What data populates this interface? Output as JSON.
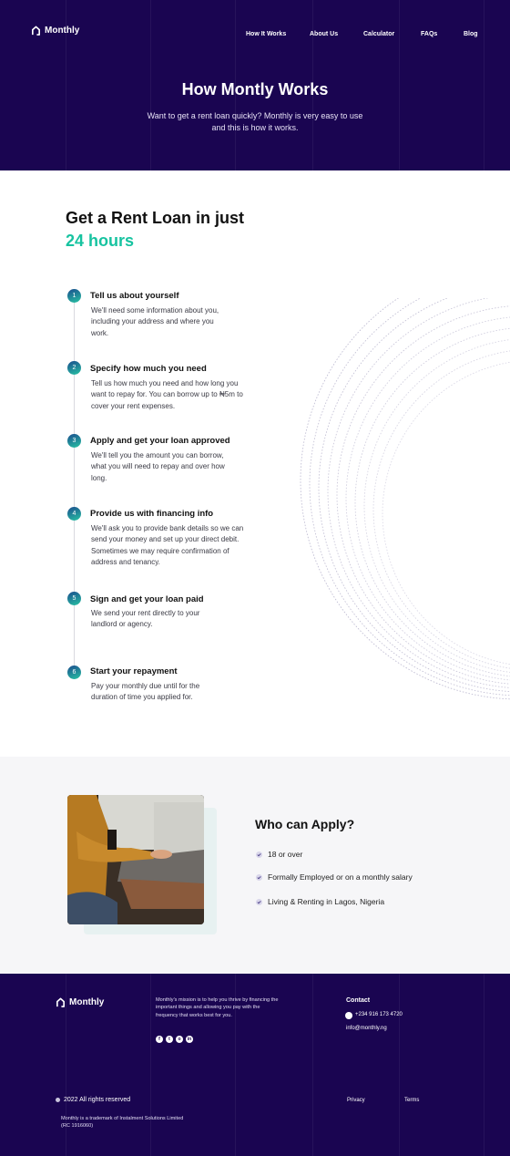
{
  "header": {
    "logo_text": "Monthly",
    "nav": [
      "How It Works",
      "About Us",
      "Calculator",
      "FAQs",
      "Blog"
    ],
    "title": "How Montly Works",
    "subtitle": "Want to get a rent loan quickly? Monthly is very easy to use and this is how it works."
  },
  "steps_section": {
    "heading": "Get a Rent Loan in just",
    "heading_accent": "24 hours",
    "steps": [
      {
        "num": "1",
        "title": "Tell us about yourself",
        "text": "We'll need some information about you, including your address and where you work."
      },
      {
        "num": "2",
        "title": "Specify how much you need",
        "text": "Tell us how much you need and how long you want to repay for. You can borrow up to ₦5m to cover your rent expenses."
      },
      {
        "num": "3",
        "title": "Apply and get your loan approved",
        "text": "We'll tell you the amount you can borrow, what you will need to repay and over how long."
      },
      {
        "num": "4",
        "title": "Provide us with financing info",
        "text": "We'll ask you to provide bank details so we can send your money and set up your direct debit. Sometimes we may require confirmation of address and tenancy."
      },
      {
        "num": "5",
        "title": "Sign and get your loan paid",
        "text": "We send your rent directly to your landlord or agency."
      },
      {
        "num": "6",
        "title": "Start your repayment",
        "text": "Pay your monthly due until for the duration of time you applied for."
      }
    ]
  },
  "apply_section": {
    "title": "Who can Apply?",
    "items": [
      "18 or over",
      "Formally Employed or on a monthly salary",
      "Living & Renting in Lagos, Nigeria"
    ]
  },
  "footer": {
    "logo_text": "Monthly",
    "mission": "Monthly's mission is to help you thrive by financing the important things and allowing you pay with the frequency that works best for you.",
    "social": [
      "facebook-icon",
      "twitter-icon",
      "instagram-icon",
      "linkedin-icon"
    ],
    "contact_title": "Contact",
    "phone": "+234 916 173 4720",
    "email": "info@monthly.ng",
    "copyright": "2022 All rights reserved",
    "links": [
      "Privacy",
      "Terms"
    ],
    "trademark": "Monthly is a trademark of Instalment Solutions Limited (RC 1916060)"
  },
  "colors": {
    "navy": "#1a0551",
    "accent": "#17c3a0",
    "light_bg": "#f6f6f8"
  }
}
